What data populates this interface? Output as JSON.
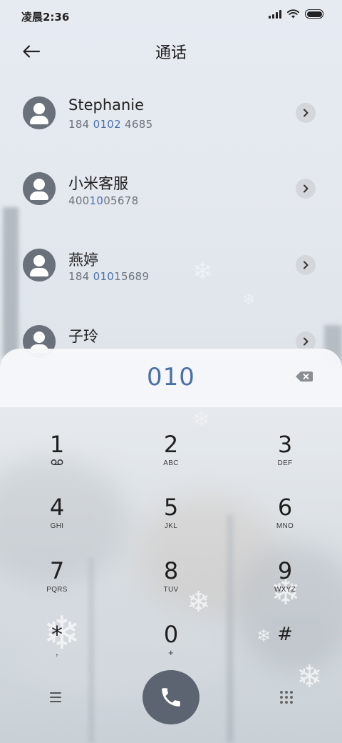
{
  "status_bar": {
    "time": "凌晨2:36",
    "icons": [
      "signal-icon",
      "wifi-icon",
      "battery-icon"
    ],
    "battery_level": 1.0
  },
  "header": {
    "back_icon": "arrow-left-icon",
    "title": "通话"
  },
  "contacts": [
    {
      "name": "Stephanie",
      "number_prefix": "184 ",
      "number_match": "0102",
      "number_suffix": " 4685"
    },
    {
      "name": "小米客服",
      "number_prefix": "400",
      "number_match": "10",
      "number_suffix": "05678"
    },
    {
      "name": "燕婷",
      "number_prefix": "184 ",
      "number_match": "010",
      "number_suffix": "15689"
    },
    {
      "name": "子玲",
      "number_prefix": "",
      "number_match": "",
      "number_suffix": ""
    }
  ],
  "dialer": {
    "input": "010",
    "backspace_icon": "backspace-icon",
    "keys": [
      {
        "digit": "1",
        "letters": "voicemail-icon"
      },
      {
        "digit": "2",
        "letters": "ABC"
      },
      {
        "digit": "3",
        "letters": "DEF"
      },
      {
        "digit": "4",
        "letters": "GHI"
      },
      {
        "digit": "5",
        "letters": "JKL"
      },
      {
        "digit": "6",
        "letters": "MNO"
      },
      {
        "digit": "7",
        "letters": "PQRS"
      },
      {
        "digit": "8",
        "letters": "TUV"
      },
      {
        "digit": "9",
        "letters": "WXYZ"
      },
      {
        "digit": "*",
        "letters": ","
      },
      {
        "digit": "0",
        "letters": "+"
      },
      {
        "digit": "#",
        "letters": ""
      }
    ]
  },
  "bottom_bar": {
    "menu_icon": "menu-icon",
    "call_icon": "phone-icon",
    "keypad_icon": "keypad-grid-icon"
  },
  "colors": {
    "accent": "#4a6fa8",
    "call_button": "#5b6470",
    "avatar": "#6a717a"
  }
}
